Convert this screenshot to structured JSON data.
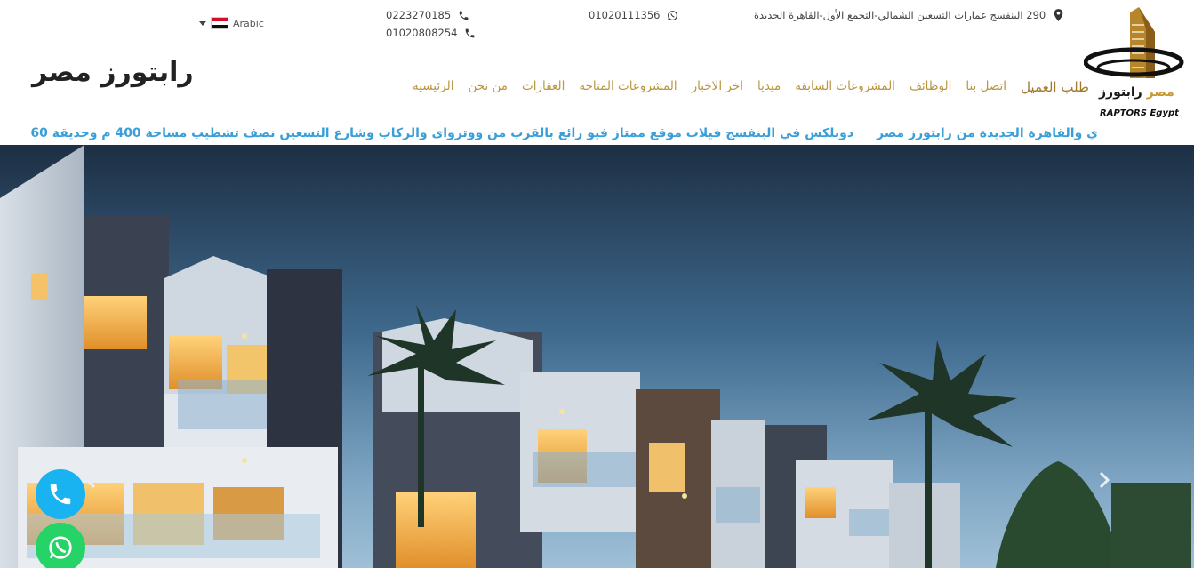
{
  "language": {
    "label": "Arabic",
    "flag": "egypt-flag-icon"
  },
  "contacts": {
    "address": "290 البنفسج عمارات التسعين الشمالي-التجمع الأول-القاهرة الجديدة",
    "whatsapp": "01020111356",
    "phone_1": "0223270185",
    "phone_2": "01020808254"
  },
  "site_title": "رابتورز مصر",
  "brand": {
    "arabic_1": "رابتورز",
    "arabic_2": "مصر",
    "english": "RAPTORS Egypt"
  },
  "nav": [
    {
      "label": "الرئيسية"
    },
    {
      "label": "من نحن"
    },
    {
      "label": "العقارات"
    },
    {
      "label": "المشروعات المتاحة"
    },
    {
      "label": "اخر الاخبار"
    },
    {
      "label": "ميديا"
    },
    {
      "label": "المشروعات السابقة"
    },
    {
      "label": "الوظائف"
    },
    {
      "label": "اتصل بنا"
    },
    {
      "label": "طلب العميل"
    }
  ],
  "ticker": [
    "ي والقاهرة الجديدة من رابتورز مصر",
    "دوبلكس في البنفسج فيلات موقع ممتاز فيو رائع بالقرب من ووتروای والركاب وشارع التسعين نصف تشطيب مساحة 400 م وحديقة 60"
  ],
  "colors": {
    "nav": "#b8963f",
    "ticker": "#3a9fd8",
    "call": "#18b3f0",
    "whatsapp": "#25d366"
  }
}
